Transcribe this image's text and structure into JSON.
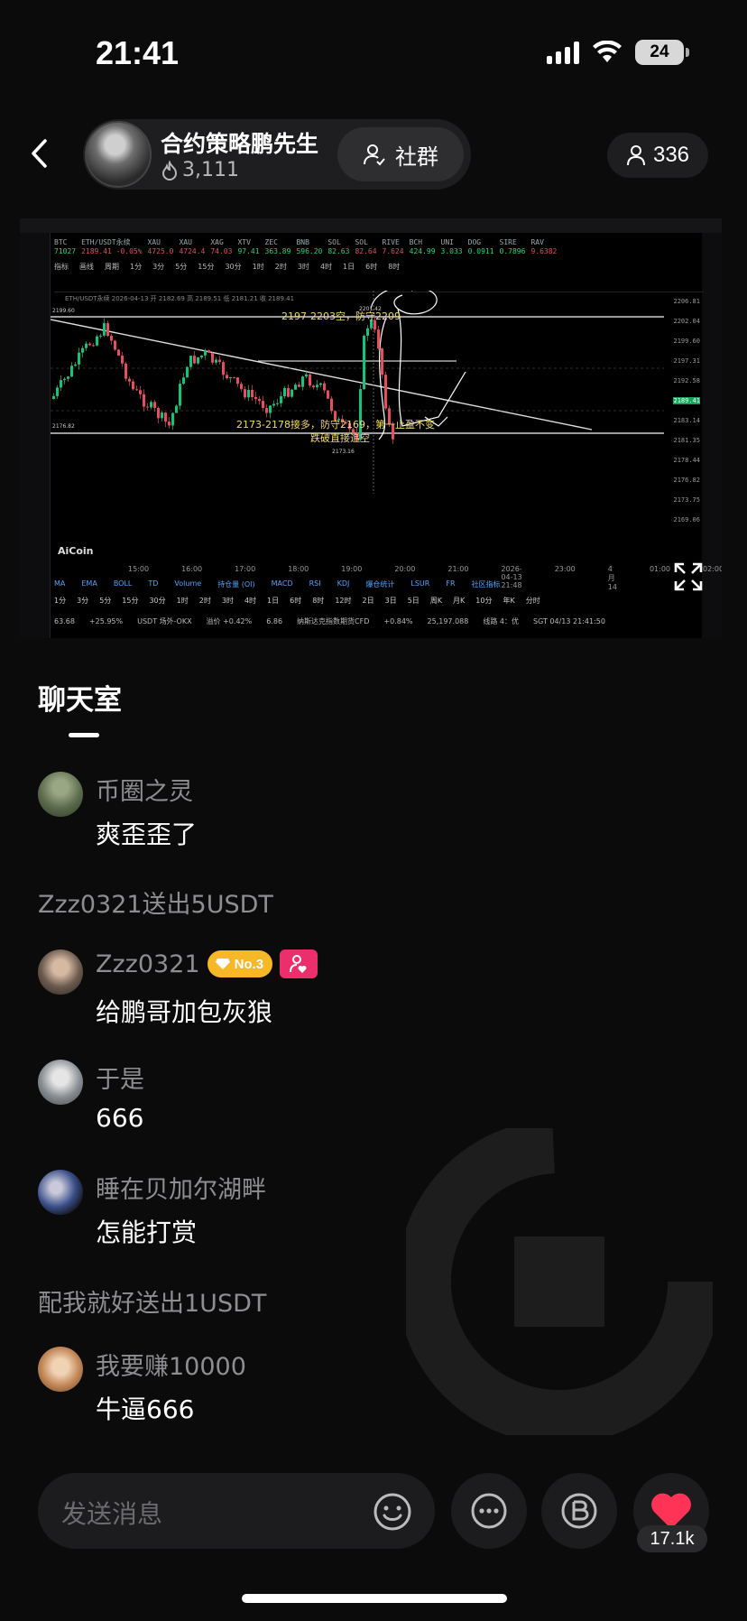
{
  "status": {
    "time": "21:41",
    "battery": "24"
  },
  "host": {
    "name": "合约策略鹏先生",
    "likes": "3,111"
  },
  "header": {
    "community_label": "社群",
    "viewers": "336"
  },
  "chart": {
    "symbol": "ETH/USDT永续",
    "ticker": [
      {
        "name": "BTC",
        "price": "71027",
        "dir": "up"
      },
      {
        "name": "ETH/USDT永续",
        "price": "2189.41 -0.05%",
        "dir": "dn"
      },
      {
        "name": "XAU",
        "price": "4725.0",
        "dir": "dn"
      },
      {
        "name": "XAU",
        "price": "4724.4",
        "dir": "dn"
      },
      {
        "name": "XAG",
        "price": "74.03",
        "dir": "dn"
      },
      {
        "name": "XTV",
        "price": "97.41",
        "dir": "up"
      },
      {
        "name": "ZEC",
        "price": "363.89",
        "dir": "up"
      },
      {
        "name": "BNB",
        "price": "596.20",
        "dir": "up"
      },
      {
        "name": "SOL",
        "price": "82.63",
        "dir": "up"
      },
      {
        "name": "SOL",
        "price": "82.64",
        "dir": "dn"
      },
      {
        "name": "RIVE",
        "price": "7.624",
        "dir": "dn"
      },
      {
        "name": "BCH",
        "price": "424.99",
        "dir": "up"
      },
      {
        "name": "UNI",
        "price": "3.033",
        "dir": "up"
      },
      {
        "name": "DOG",
        "price": "0.0911",
        "dir": "up"
      },
      {
        "name": "SIRE",
        "price": "0.7896",
        "dir": "up"
      },
      {
        "name": "RAV",
        "price": "9.6382",
        "dir": "dn"
      }
    ],
    "timeframes": [
      "指标",
      "画线",
      "周期",
      "1分",
      "3分",
      "5分",
      "15分",
      "30分",
      "1时",
      "2时",
      "3时",
      "4时",
      "1日",
      "6时",
      "8时"
    ],
    "ohlc": "ETH/USDT永续 2026-04-13 开 2182.69 高 2189.51 低 2181.21 收 2189.41",
    "annotation_short": "2197-2203空，防守2209",
    "annotation_long": "2173-2178接多，防守2169，第一止盈不变",
    "annotation_break": "跌破直接追空",
    "level_high_label": "2201.42",
    "level_low_label": "2173.16",
    "level_left_top": "2199.60",
    "level_left_bottom": "2176.82",
    "prices": [
      "2206.81",
      "2202.04",
      "2199.60",
      "2197.31",
      "2192.58",
      "2189.41",
      "2183.14",
      "2181.35",
      "2178.44",
      "2176.82",
      "2173.75",
      "2169.06"
    ],
    "times": [
      "15:00",
      "16:00",
      "17:00",
      "18:00",
      "19:00",
      "20:00",
      "21:00",
      "2026-04-13 21:48",
      "23:00",
      "4月14",
      "01:00",
      "02:00"
    ],
    "indicators": [
      "MA",
      "EMA",
      "BOLL",
      "TD",
      "Volume",
      "持仓量 (OI)",
      "MACD",
      "RSI",
      "KDJ",
      "爆仓统计",
      "LSUR",
      "FR",
      "社区指标"
    ],
    "periods": [
      "1分",
      "3分",
      "5分",
      "15分",
      "30分",
      "1时",
      "2时",
      "3时",
      "4时",
      "1日",
      "6时",
      "8时",
      "12时",
      "2日",
      "3日",
      "5日",
      "周K",
      "月K",
      "10分",
      "年K",
      "分时"
    ],
    "bottom_strip": [
      "63.68",
      "+25.95%",
      "USDT 场外-OKX",
      "溢价 +0.42%",
      "6.86",
      "纳斯达克指数期货CFD",
      "+0.84%",
      "25,197.088",
      "线路 4：优",
      "SGT 04/13 21:41:50"
    ],
    "brand": "AiCoin"
  },
  "chat": {
    "title": "聊天室",
    "messages": [
      {
        "type": "msg",
        "user": "币圈之灵",
        "text": "爽歪歪了",
        "avatar_color": "#5b6b4c"
      },
      {
        "type": "gift",
        "text": "Zzz0321送出5USDT"
      },
      {
        "type": "msg",
        "user": "Zzz0321",
        "text": "给鹏哥加包灰狼",
        "badge": "No.3",
        "avatar_color": "#6b5a4e"
      },
      {
        "type": "msg",
        "user": "于是",
        "text": "666",
        "avatar_color": "#8a8f94"
      },
      {
        "type": "msg",
        "user": "睡在贝加尔湖畔",
        "text": "怎能打赏",
        "avatar_color": "#3a4f8a"
      },
      {
        "type": "gift",
        "text": "配我就好送出1USDT"
      },
      {
        "type": "msg",
        "user": "我要赚10000",
        "text": "牛逼666",
        "avatar_color": "#c48a5a"
      }
    ]
  },
  "input": {
    "placeholder": "发送消息"
  },
  "like_count": "17.1k",
  "colors": {
    "accent_red": "#ff3355",
    "bg": "#0b0b0c",
    "badge_gold": "#f6b826",
    "badge_pink": "#ec2e6c"
  }
}
